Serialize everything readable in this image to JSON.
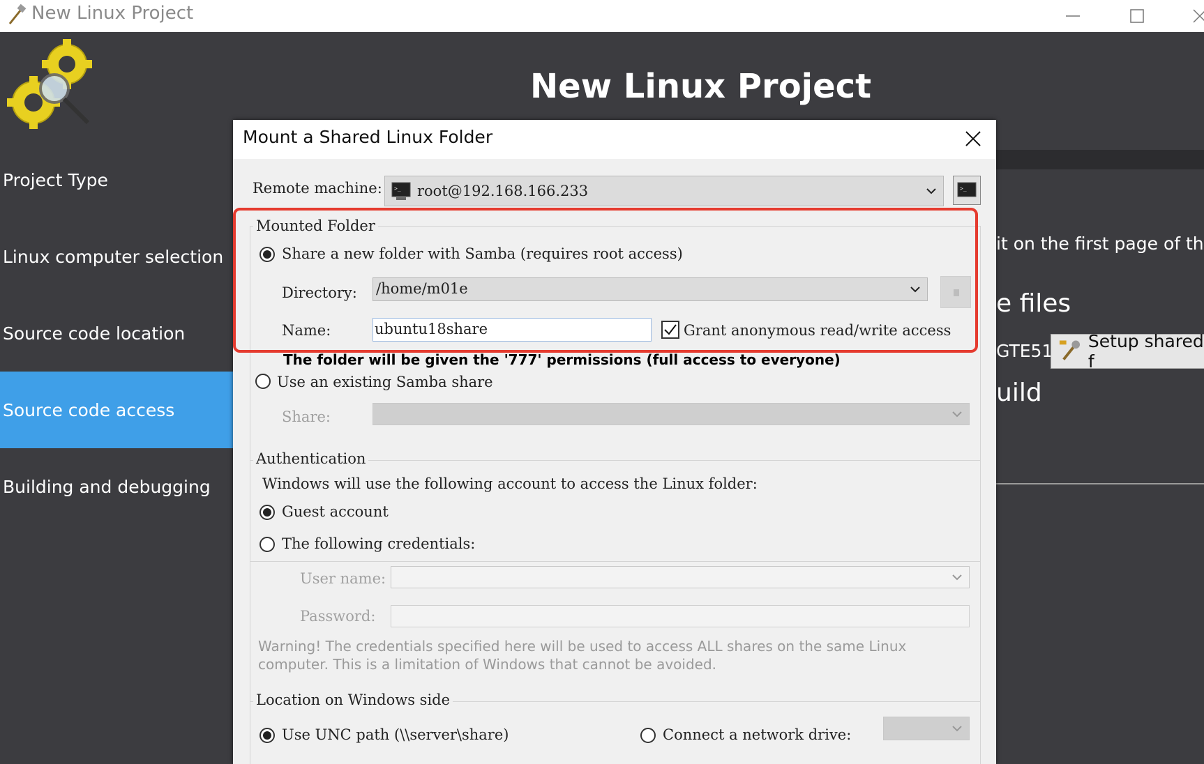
{
  "window": {
    "title": "New Linux Project"
  },
  "header": {
    "title": "New Linux Project",
    "logo_icon": "gears-magnifier-icon"
  },
  "sidebar": {
    "items": [
      {
        "label": "Project Type",
        "active": false
      },
      {
        "label": "Linux computer selection",
        "active": false
      },
      {
        "label": "Source code location",
        "active": false
      },
      {
        "label": "Source code access",
        "active": true
      },
      {
        "label": "Building and debugging",
        "active": false
      }
    ]
  },
  "background_panel": {
    "line1": "it on the first page of the",
    "line2": "e files",
    "line3": "GTE51",
    "setup_button_label": "Setup shared f",
    "line4": "uild"
  },
  "dialog": {
    "title": "Mount a Shared Linux Folder",
    "remote_machine_label": "Remote machine:",
    "remote_machine_value": "root@192.168.166.233",
    "mounted_folder": {
      "group_label": "Mounted Folder",
      "share_new_label": "Share a new folder with Samba (requires root access)",
      "share_new_selected": true,
      "directory_label": "Directory:",
      "directory_value": "/home/m01e",
      "name_label": "Name:",
      "name_value": "ubuntu18share",
      "grant_anonymous_label": "Grant anonymous read/write access",
      "grant_anonymous_checked": true,
      "permissions_note": "The folder will be given the '777' permissions (full access to everyone)",
      "use_existing_label": "Use an existing Samba share",
      "use_existing_selected": false,
      "share_label": "Share:"
    },
    "authentication": {
      "group_label": "Authentication",
      "description": "Windows will use the following account to access the Linux folder:",
      "guest_label": "Guest account",
      "guest_selected": true,
      "credentials_label": "The following credentials:",
      "credentials_selected": false,
      "username_label": "User name:",
      "password_label": "Password:",
      "warning": "Warning! The credentials specified here will be used to access ALL shares on the same Linux computer. This is a limitation of Windows that cannot be avoided."
    },
    "location": {
      "group_label": "Location on Windows side",
      "unc_label": "Use UNC path (\\\\server\\share)",
      "unc_selected": true,
      "network_drive_label": "Connect a network drive:",
      "network_drive_selected": false
    }
  },
  "colors": {
    "sidebar_active": "#3f9fe8",
    "background": "#3c3c40",
    "dialog": "#f0f0f0",
    "highlight": "#e53b2f"
  }
}
